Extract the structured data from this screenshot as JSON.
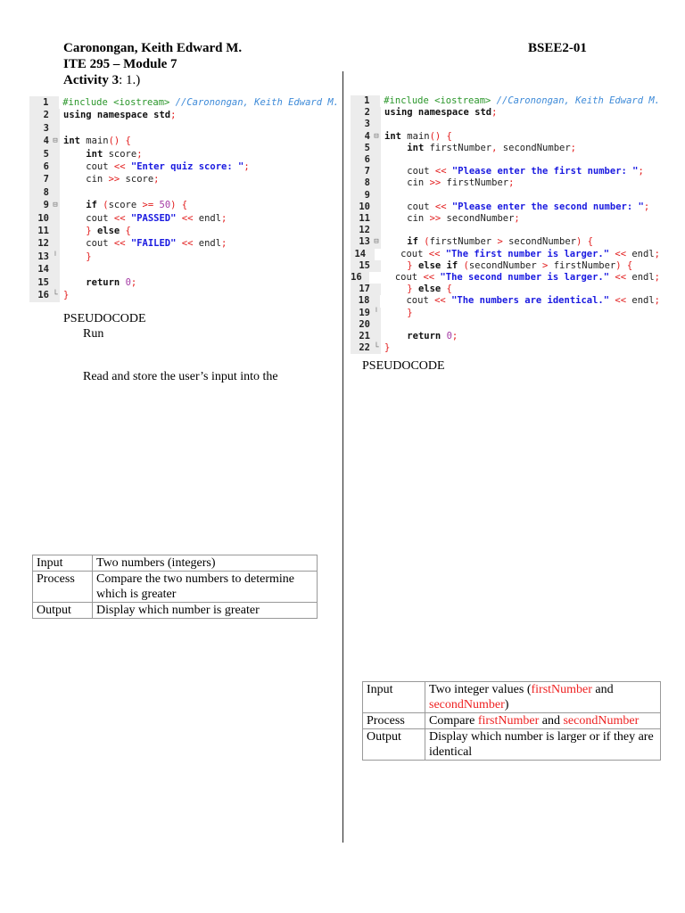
{
  "header": {
    "name": "Caronongan, Keith Edward M.",
    "section": "BSEE2-01",
    "course": "ITE 295 – Module 7",
    "activity_label": "Activity 3",
    "activity_value": ": 1.)"
  },
  "left": {
    "code": [
      [
        [
          "pp",
          "#include <iostream> "
        ],
        [
          "cmt",
          "//Caronongan, Keith Edward M."
        ]
      ],
      [
        [
          "kw",
          "using namespace std"
        ],
        [
          "op",
          ";"
        ]
      ],
      [],
      [
        [
          "kw",
          "int "
        ],
        [
          "pl",
          "main"
        ],
        [
          "op",
          "() {"
        ]
      ],
      [
        [
          "pl",
          "    "
        ],
        [
          "kw",
          "int "
        ],
        [
          "pl",
          "score"
        ],
        [
          "op",
          ";"
        ]
      ],
      [
        [
          "pl",
          "    cout "
        ],
        [
          "op",
          "<< "
        ],
        [
          "str",
          "\"Enter quiz score: \""
        ],
        [
          "op",
          ";"
        ]
      ],
      [
        [
          "pl",
          "    cin "
        ],
        [
          "op",
          ">> "
        ],
        [
          "pl",
          "score"
        ],
        [
          "op",
          ";"
        ]
      ],
      [],
      [
        [
          "pl",
          "    "
        ],
        [
          "kw",
          "if "
        ],
        [
          "op",
          "("
        ],
        [
          "pl",
          "score "
        ],
        [
          "op",
          ">= "
        ],
        [
          "num",
          "50"
        ],
        [
          "op",
          ") {"
        ]
      ],
      [
        [
          "pl",
          "    cout "
        ],
        [
          "op",
          "<< "
        ],
        [
          "str",
          "\"PASSED\""
        ],
        [
          "op",
          " << "
        ],
        [
          "pl",
          "endl"
        ],
        [
          "op",
          ";"
        ]
      ],
      [
        [
          "op",
          "    } "
        ],
        [
          "kw",
          "else "
        ],
        [
          "op",
          "{"
        ]
      ],
      [
        [
          "pl",
          "    cout "
        ],
        [
          "op",
          "<< "
        ],
        [
          "str",
          "\"FAILED\""
        ],
        [
          "op",
          " << "
        ],
        [
          "pl",
          "endl"
        ],
        [
          "op",
          ";"
        ]
      ],
      [
        [
          "op",
          "    }"
        ]
      ],
      [],
      [
        [
          "pl",
          "    "
        ],
        [
          "kw",
          "return "
        ],
        [
          "num",
          "0"
        ],
        [
          "op",
          ";"
        ]
      ],
      [
        [
          "op",
          "}"
        ]
      ]
    ],
    "pseudocode_label": "PSEUDOCODE",
    "run_label": "Run",
    "read_text": "Read and store the user’s input into the",
    "table": [
      [
        "Input",
        "Two numbers (integers)"
      ],
      [
        "Process",
        "Compare the two numbers to determine which is greater"
      ],
      [
        "Output",
        "Display which number is greater"
      ]
    ]
  },
  "right": {
    "code": [
      [
        [
          "pp",
          "#include <iostream> "
        ],
        [
          "cmt",
          "//Caronongan, Keith Edward M."
        ]
      ],
      [
        [
          "kw",
          "using namespace std"
        ],
        [
          "op",
          ";"
        ]
      ],
      [],
      [
        [
          "kw",
          "int "
        ],
        [
          "pl",
          "main"
        ],
        [
          "op",
          "() {"
        ]
      ],
      [
        [
          "pl",
          "    "
        ],
        [
          "kw",
          "int "
        ],
        [
          "pl",
          "firstNumber"
        ],
        [
          "op",
          ", "
        ],
        [
          "pl",
          "secondNumber"
        ],
        [
          "op",
          ";"
        ]
      ],
      [],
      [
        [
          "pl",
          "    cout "
        ],
        [
          "op",
          "<< "
        ],
        [
          "str",
          "\"Please enter the first number: \""
        ],
        [
          "op",
          ";"
        ]
      ],
      [
        [
          "pl",
          "    cin "
        ],
        [
          "op",
          ">> "
        ],
        [
          "pl",
          "firstNumber"
        ],
        [
          "op",
          ";"
        ]
      ],
      [],
      [
        [
          "pl",
          "    cout "
        ],
        [
          "op",
          "<< "
        ],
        [
          "str",
          "\"Please enter the second number: \""
        ],
        [
          "op",
          ";"
        ]
      ],
      [
        [
          "pl",
          "    cin "
        ],
        [
          "op",
          ">> "
        ],
        [
          "pl",
          "secondNumber"
        ],
        [
          "op",
          ";"
        ]
      ],
      [],
      [
        [
          "pl",
          "    "
        ],
        [
          "kw",
          "if "
        ],
        [
          "op",
          "("
        ],
        [
          "pl",
          "firstNumber "
        ],
        [
          "op",
          "> "
        ],
        [
          "pl",
          "secondNumber"
        ],
        [
          "op",
          ") {"
        ]
      ],
      [
        [
          "pl",
          "    cout "
        ],
        [
          "op",
          "<< "
        ],
        [
          "str",
          "\"The first number is larger.\""
        ],
        [
          "op",
          " << "
        ],
        [
          "pl",
          "endl"
        ],
        [
          "op",
          ";"
        ]
      ],
      [
        [
          "op",
          "    } "
        ],
        [
          "kw",
          "else if "
        ],
        [
          "op",
          "("
        ],
        [
          "pl",
          "secondNumber "
        ],
        [
          "op",
          "> "
        ],
        [
          "pl",
          "firstNumber"
        ],
        [
          "op",
          ") {"
        ]
      ],
      [
        [
          "pl",
          "    cout "
        ],
        [
          "op",
          "<< "
        ],
        [
          "str",
          "\"The second number is larger.\""
        ],
        [
          "op",
          " << "
        ],
        [
          "pl",
          "endl"
        ],
        [
          "op",
          ";"
        ]
      ],
      [
        [
          "op",
          "    } "
        ],
        [
          "kw",
          "else "
        ],
        [
          "op",
          "{"
        ]
      ],
      [
        [
          "pl",
          "    cout "
        ],
        [
          "op",
          "<< "
        ],
        [
          "str",
          "\"The numbers are identical.\""
        ],
        [
          "op",
          " << "
        ],
        [
          "pl",
          "endl"
        ],
        [
          "op",
          ";"
        ]
      ],
      [
        [
          "op",
          "    }"
        ]
      ],
      [],
      [
        [
          "pl",
          "    "
        ],
        [
          "kw",
          "return "
        ],
        [
          "num",
          "0"
        ],
        [
          "op",
          ";"
        ]
      ],
      [
        [
          "op",
          "}"
        ]
      ]
    ],
    "pseudocode_label": "PSEUDOCODE",
    "table": {
      "input_label": "Input",
      "input_a": "Two integer values (",
      "input_var1": "firstNumber",
      "input_b": " and ",
      "input_var2": "secondNumber",
      "input_c": ")",
      "process_label": "Process",
      "process_a": "Compare ",
      "process_var1": "firstNumber",
      "process_b": " and ",
      "process_var2": "secondNumber",
      "output_label": "Output",
      "output_value": "Display which number is larger or if they are identical"
    }
  },
  "fold_markers": {
    "left": {
      "4": "⊟",
      "9": "⊟",
      "13": "╵",
      "16": "└"
    },
    "right": {
      "4": "⊟",
      "13": "⊟",
      "19": "╵",
      "22": "└"
    }
  }
}
